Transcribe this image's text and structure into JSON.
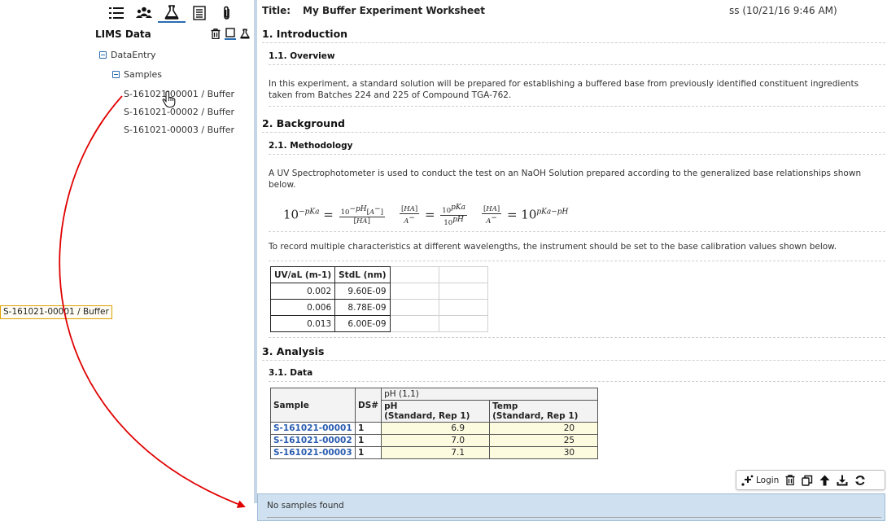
{
  "left_panel": {
    "panel_title": "LIMS Data",
    "tree": {
      "root": "DataEntry",
      "child": "Samples",
      "items": [
        "S-161021-00001 / Buffer",
        "S-161021-00002 / Buffer",
        "S-161021-00003 / Buffer"
      ]
    },
    "drag_tooltip": "S-161021-00001 / Buffer"
  },
  "worksheet": {
    "title_label": "Title:",
    "title": "My Buffer Experiment Worksheet",
    "meta": "ss (10/21/16 9:46 AM)",
    "sec1": "1.  Introduction",
    "sec1_1": "1.1.  Overview",
    "sec1_text": "In this experiment, a standard solution will be prepared for establishing a buffered base from previously identified constituent ingredients taken from Batches 224 and 225 of Compound TGA-762.",
    "sec2": "2.  Background",
    "sec2_1": "2.1.  Methodology",
    "sec2_text": "A UV Spectrophotometer is used to conduct the test on an NaOH Solution prepared according to the generalized base relationships shown below.",
    "sec2_text2": "To record multiple characteristics at different wavelengths, the instrument should be set to the base calibration values shown below.",
    "calib_table": {
      "headers": [
        "UV/aL (m-1)",
        "StdL (nm)"
      ],
      "rows": [
        [
          "0.002",
          "9.60E-09"
        ],
        [
          "0.006",
          "8.78E-09"
        ],
        [
          "0.013",
          "6.00E-09"
        ]
      ]
    },
    "sec3": "3.  Analysis",
    "sec3_1": "3.1.  Data",
    "data_table": {
      "h_sample": "Sample",
      "h_ds": "DS#",
      "h_group": "pH (1,1)",
      "h_ph": "pH",
      "h_ph_sub": "(Standard, Rep 1)",
      "h_temp": "Temp",
      "h_temp_sub": "(Standard, Rep 1)",
      "rows": [
        {
          "sample": "S-161021-00001",
          "ds": "1",
          "ph": "6.9",
          "temp": "20"
        },
        {
          "sample": "S-161021-00002",
          "ds": "1",
          "ph": "7.0",
          "temp": "25"
        },
        {
          "sample": "S-161021-00003",
          "ds": "1",
          "ph": "7.1",
          "temp": "30"
        }
      ]
    }
  },
  "action_bar": {
    "login_label": "Login"
  },
  "drop_zone": {
    "text": "No samples found"
  },
  "colors": {
    "accent": "#2a6db0",
    "drop_zone_bg": "#cfe0f0",
    "arrow": "#e00000",
    "sample_link": "#2a5db0",
    "input_cell": "#fdfbdf"
  }
}
